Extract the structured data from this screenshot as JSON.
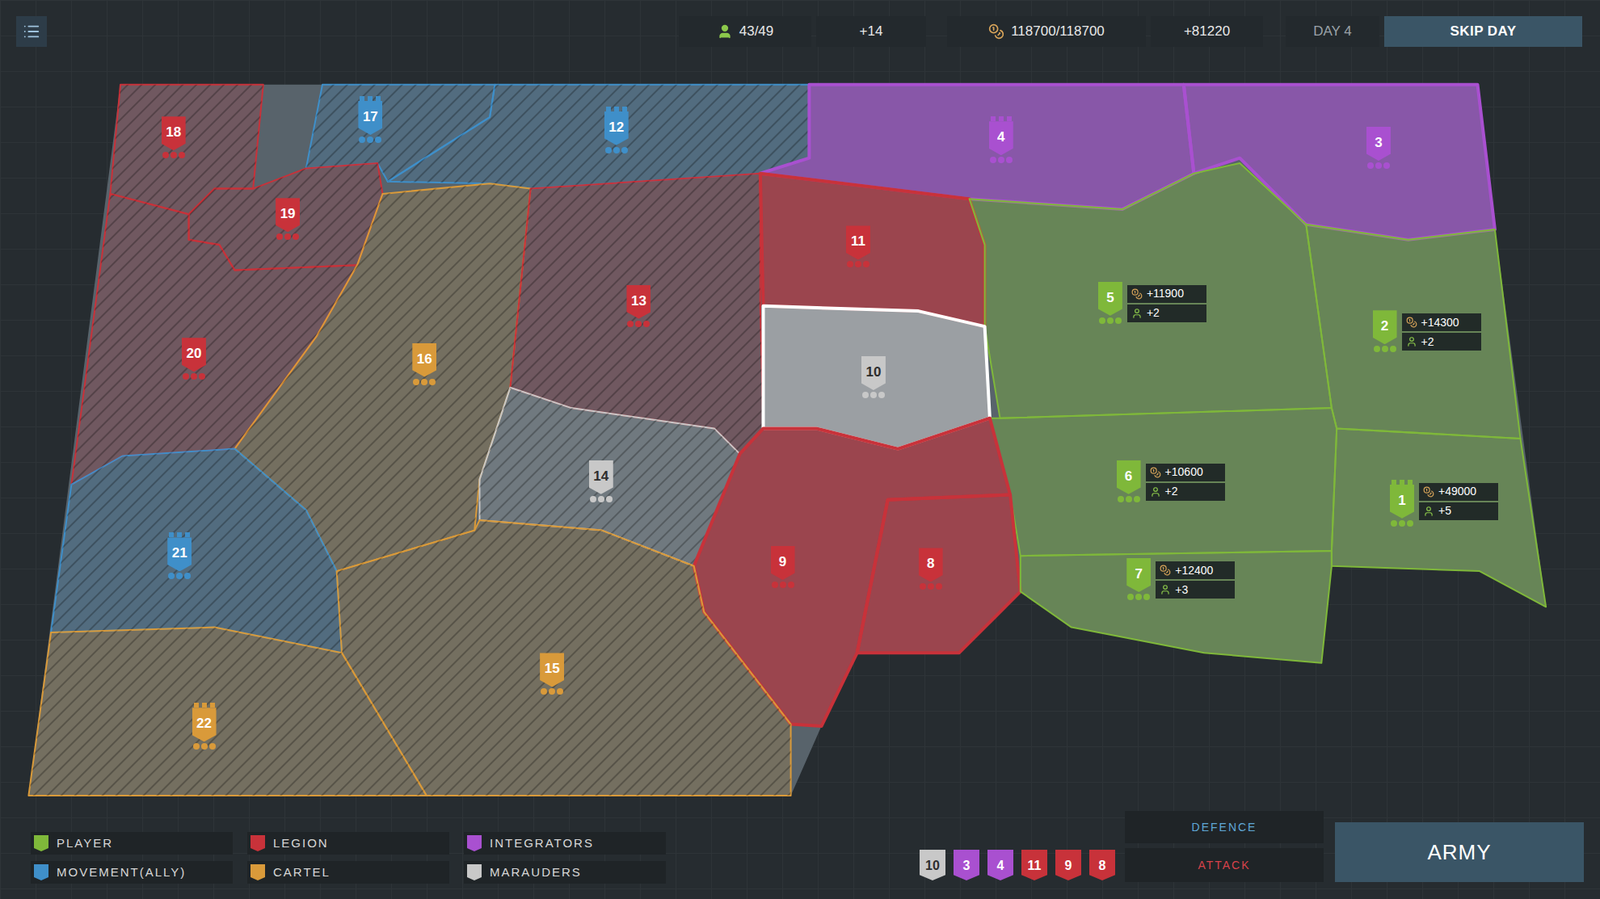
{
  "topbar": {
    "population": "43/49",
    "population_gain": "+14",
    "resources": "118700/118700",
    "resources_gain": "+81220",
    "day": "DAY 4",
    "skip_button": "SKIP DAY"
  },
  "factions": [
    {
      "name": "PLAYER",
      "color": "#7fb83a"
    },
    {
      "name": "LEGION",
      "color": "#c8323a"
    },
    {
      "name": "INTEGRATORS",
      "color": "#a950d0"
    },
    {
      "name": "MOVEMENT(ALLY)",
      "color": "#3f8fc9"
    },
    {
      "name": "CARTEL",
      "color": "#d99a3a"
    },
    {
      "name": "MARAUDERS",
      "color": "#c8c8c8"
    }
  ],
  "regions": [
    {
      "number": "18",
      "faction": "LEGION",
      "kind": "flag",
      "highlighted": false
    },
    {
      "number": "17",
      "faction": "MOVEMENT(ALLY)",
      "kind": "capital",
      "highlighted": false
    },
    {
      "number": "12",
      "faction": "MOVEMENT(ALLY)",
      "kind": "capital",
      "highlighted": false
    },
    {
      "number": "4",
      "faction": "INTEGRATORS",
      "kind": "capital",
      "highlighted": true
    },
    {
      "number": "3",
      "faction": "INTEGRATORS",
      "kind": "flag",
      "highlighted": true
    },
    {
      "number": "19",
      "faction": "LEGION",
      "kind": "flag",
      "highlighted": false
    },
    {
      "number": "20",
      "faction": "LEGION",
      "kind": "flag",
      "highlighted": false
    },
    {
      "number": "16",
      "faction": "CARTEL",
      "kind": "flag",
      "highlighted": false
    },
    {
      "number": "13",
      "faction": "LEGION",
      "kind": "flag",
      "highlighted": false
    },
    {
      "number": "11",
      "faction": "LEGION",
      "kind": "flag",
      "highlighted": true
    },
    {
      "number": "5",
      "faction": "PLAYER",
      "kind": "flag",
      "highlighted": false,
      "income": {
        "resources": "+11900",
        "population": "+2"
      }
    },
    {
      "number": "2",
      "faction": "PLAYER",
      "kind": "flag",
      "highlighted": false,
      "income": {
        "resources": "+14300",
        "population": "+2"
      }
    },
    {
      "number": "10",
      "faction": "MARAUDERS",
      "kind": "flag",
      "highlighted": true
    },
    {
      "number": "14",
      "faction": "MARAUDERS",
      "kind": "flag",
      "highlighted": false
    },
    {
      "number": "6",
      "faction": "PLAYER",
      "kind": "flag",
      "highlighted": false,
      "income": {
        "resources": "+10600",
        "population": "+2"
      }
    },
    {
      "number": "1",
      "faction": "PLAYER",
      "kind": "capital",
      "highlighted": false,
      "income": {
        "resources": "+49000",
        "population": "+5"
      }
    },
    {
      "number": "9",
      "faction": "LEGION",
      "kind": "flag",
      "highlighted": true
    },
    {
      "number": "8",
      "faction": "LEGION",
      "kind": "flag",
      "highlighted": true
    },
    {
      "number": "7",
      "faction": "PLAYER",
      "kind": "flag",
      "highlighted": false,
      "income": {
        "resources": "+12400",
        "population": "+3"
      }
    },
    {
      "number": "21",
      "faction": "MOVEMENT(ALLY)",
      "kind": "capital",
      "highlighted": false
    },
    {
      "number": "15",
      "faction": "CARTEL",
      "kind": "flag",
      "highlighted": false
    },
    {
      "number": "22",
      "faction": "CARTEL",
      "kind": "capital",
      "highlighted": false
    }
  ],
  "queue": [
    {
      "number": "10",
      "faction": "MARAUDERS"
    },
    {
      "number": "3",
      "faction": "INTEGRATORS"
    },
    {
      "number": "4",
      "faction": "INTEGRATORS"
    },
    {
      "number": "11",
      "faction": "LEGION"
    },
    {
      "number": "9",
      "faction": "LEGION"
    },
    {
      "number": "8",
      "faction": "LEGION"
    }
  ],
  "defence_label": "DEFENCE",
  "attack_label": "ATTACK",
  "army_button": "ARMY"
}
